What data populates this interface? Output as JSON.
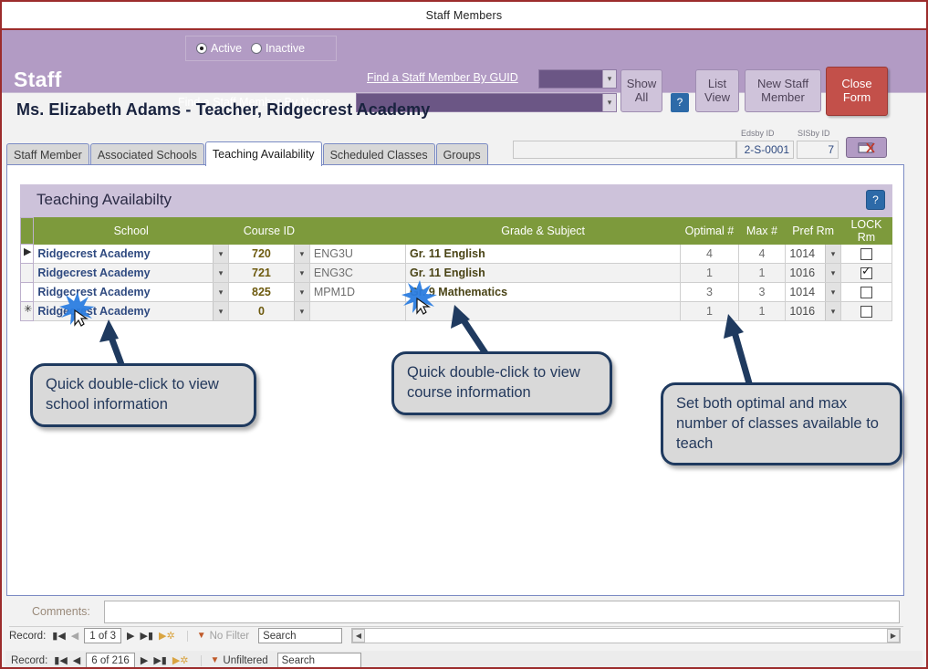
{
  "window": {
    "title": "Staff Members"
  },
  "header": {
    "brand": "Staff",
    "status_filter": {
      "active_label": "Active",
      "inactive_label": "Inactive",
      "selected": "Active"
    },
    "find_by_guid_label": "Find a Staff Member By GUID",
    "find_by_name_label": "Find a Staff Member By Name",
    "guid_value": "",
    "name_value": "",
    "buttons": {
      "show_all": "Show All",
      "help": "?",
      "list_view": "List View",
      "new_staff_member": "New Staff Member",
      "close_form": "Close Form"
    },
    "colors": {
      "band": "#b29bc4",
      "close_form": "#c3504a",
      "help": "#2d6aa8"
    }
  },
  "person": {
    "title": "Ms. Elizabeth  Adams  - Teacher, Ridgecrest Academy"
  },
  "ids": {
    "edsby_label": "Edsby ID",
    "edsby_value": "2-S-0001",
    "sisby_label": "SISby ID",
    "sisby_value": "7",
    "strip_value": ""
  },
  "tabs": [
    {
      "label": "Staff Member",
      "active": false
    },
    {
      "label": "Associated Schools",
      "active": false
    },
    {
      "label": "Teaching Availability",
      "active": true
    },
    {
      "label": "Scheduled Classes",
      "active": false
    },
    {
      "label": "Groups",
      "active": false
    }
  ],
  "section": {
    "title": "Teaching Availabilty",
    "help": "?",
    "header_color": "#cdc2da",
    "grid_header_color": "#7d9a3c"
  },
  "grid": {
    "columns": [
      "School",
      "Course ID",
      "",
      "Grade & Subject",
      "Optimal #",
      "Max #",
      "Pref  Rm",
      "LOCK Rm"
    ],
    "rows": [
      {
        "marker": "▶",
        "school": "Ridgecrest Academy",
        "course_id": "720",
        "code": "ENG3U",
        "subject": "Gr. 11 English",
        "optimal": "4",
        "max": "4",
        "pref_rm": "1014",
        "lock": false
      },
      {
        "marker": "",
        "school": "Ridgecrest Academy",
        "course_id": "721",
        "code": "ENG3C",
        "subject": "Gr. 11 English",
        "optimal": "1",
        "max": "1",
        "pref_rm": "1016",
        "lock": true
      },
      {
        "marker": "",
        "school": "Ridgecrest Academy",
        "course_id": "825",
        "code": "MPM1D",
        "subject": "Gr. 9 Mathematics",
        "optimal": "3",
        "max": "3",
        "pref_rm": "1014",
        "lock": false
      },
      {
        "marker": "✳",
        "school": "Ridgecrest Academy",
        "course_id": "0",
        "code": "",
        "subject": "",
        "optimal": "1",
        "max": "1",
        "pref_rm": "1016",
        "lock": false
      }
    ]
  },
  "callouts": [
    {
      "text": "Quick double-click to view school information"
    },
    {
      "text": "Quick double-click to view course information"
    },
    {
      "text": "Set both optimal and max number of classes available to teach"
    }
  ],
  "comments": {
    "label": "Comments:",
    "value": ""
  },
  "nav_inner": {
    "label": "Record:",
    "position": "1 of 3",
    "filter_text": "No Filter",
    "search_placeholder": "Search"
  },
  "nav_outer": {
    "label": "Record:",
    "position": "6 of 216",
    "filter_text": "Unfiltered",
    "search_placeholder": "Search"
  }
}
